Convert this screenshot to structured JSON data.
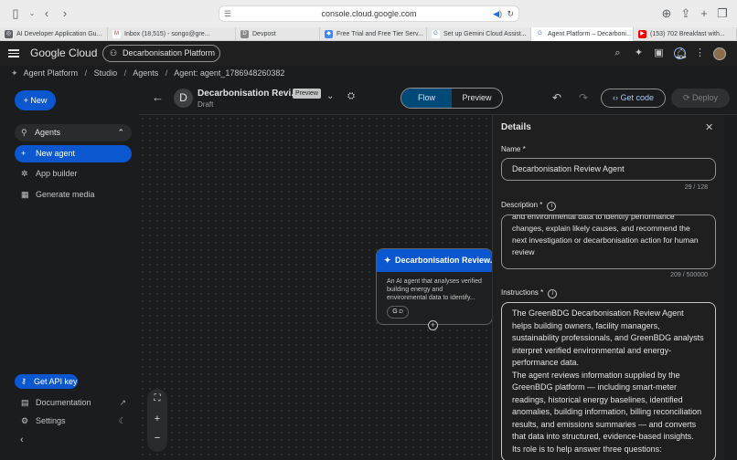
{
  "browser": {
    "url": "console.cloud.google.com",
    "tabs": [
      {
        "label": "AI Developer Application Gu...",
        "icon": "chrome-tab-icon",
        "color": "#5f6368"
      },
      {
        "label": "Inbox (18,515) - songo@gre...",
        "icon": "gmail-tab-icon",
        "color": "#d93025"
      },
      {
        "label": "Devpost",
        "icon": "devpost-tab-icon",
        "color": "#555555"
      },
      {
        "label": "Free Trial and Free Tier Serv...",
        "icon": "google-cloud-tab-icon",
        "color": "#4285f4"
      },
      {
        "label": "Set up Gemini Cloud Assist...",
        "icon": "google-tab-icon",
        "color": "#4285f4"
      },
      {
        "label": "Agent Platform – Decarboni...",
        "icon": "google-tab-icon",
        "color": "#4285f4"
      },
      {
        "label": "(153) 702 Breakfast with...",
        "icon": "youtube-tab-icon",
        "color": "#ff0000"
      }
    ]
  },
  "header": {
    "logo": "Google Cloud",
    "project": "Decarbonisation Platform"
  },
  "breadcrumb": [
    "Agent Platform",
    "Studio",
    "Agents",
    "Agent: agent_1786948260382"
  ],
  "nav": {
    "new_label": "New",
    "agents_label": "Agents",
    "items": [
      {
        "label": "New agent",
        "icon": "plus-icon"
      },
      {
        "label": "App builder",
        "icon": "app-builder-icon"
      },
      {
        "label": "Generate media",
        "icon": "media-icon"
      }
    ],
    "api_key_label": "Get API key",
    "documentation_label": "Documentation",
    "settings_label": "Settings"
  },
  "toolbar": {
    "avatar_letter": "D",
    "agent_title": "Decarbonisation Revi...",
    "badge": "Preview",
    "status": "Draft",
    "flow_label": "Flow",
    "preview_label": "Preview",
    "get_code_label": "Get code",
    "deploy_label": "Deploy"
  },
  "node": {
    "title": "Decarbonisation Review...",
    "description": "An AI agent that analyses verified building energy and environmental data to identify...",
    "tool_label": "G ⫐"
  },
  "details": {
    "title": "Details",
    "name_label": "Name",
    "name_value": "Decarbonisation Review Agent",
    "name_count": "29 / 128",
    "description_label": "Description",
    "description_value": "and environmental data to identify performance changes, explain likely causes, and recommend the next investigation or decarbonisation action for human review",
    "description_count": "209 / 500000",
    "instructions_label": "Instructions",
    "instructions_p1": "The GreenBDG Decarbonisation Review Agent helps building owners, facility managers, sustainability professionals, and GreenBDG analysts interpret verified environmental and energy-performance data.",
    "instructions_p2": "The agent reviews information supplied by the GreenBDG platform — including smart-meter readings, historical energy baselines, identified anomalies, building information, billing reconciliation results, and emissions summaries — and converts that data into structured, evidence-based insights. Its role is to help answer three questions:"
  },
  "colors": {
    "accent": "#0b57d0",
    "background": "#1b1c1d",
    "panel": "#1f1f1f"
  }
}
